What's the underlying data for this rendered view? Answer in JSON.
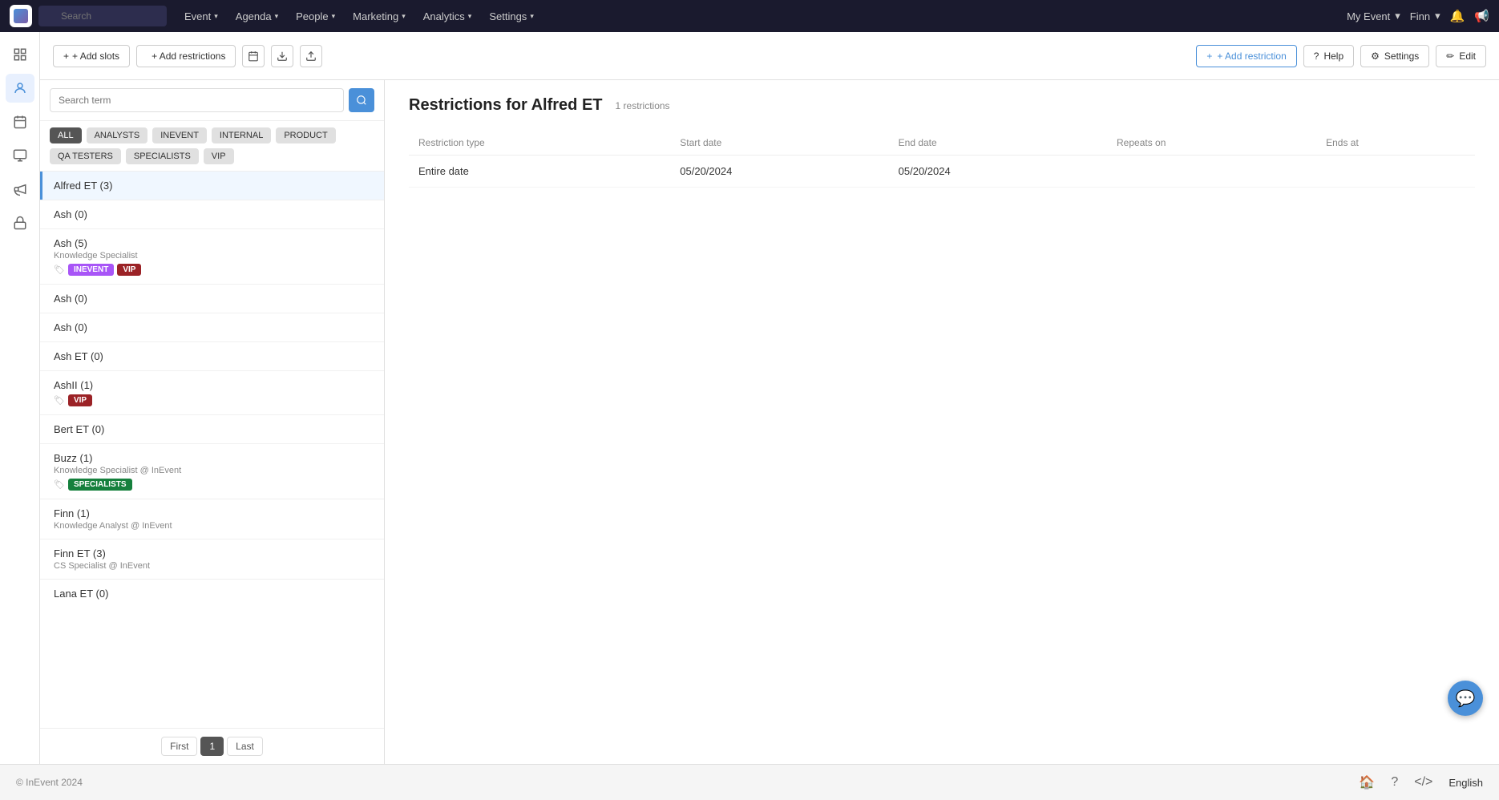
{
  "app": {
    "logo_alt": "InEvent Logo"
  },
  "topnav": {
    "search_placeholder": "Search",
    "items": [
      {
        "label": "Event",
        "has_arrow": true
      },
      {
        "label": "Agenda",
        "has_arrow": true
      },
      {
        "label": "People",
        "has_arrow": true
      },
      {
        "label": "Marketing",
        "has_arrow": true
      },
      {
        "label": "Analytics",
        "has_arrow": true
      },
      {
        "label": "Settings",
        "has_arrow": true
      }
    ],
    "my_event": "My Event",
    "user": "Finn"
  },
  "toolbar": {
    "add_slots_label": "+ Add slots",
    "add_restrictions_label": "+ Add restrictions",
    "add_restriction_label": "+ Add restriction",
    "help_label": "Help",
    "settings_label": "Settings",
    "edit_label": "Edit"
  },
  "left_panel": {
    "search_placeholder": "Search term",
    "filters": [
      {
        "label": "ALL",
        "style": "all"
      },
      {
        "label": "ANALYSTS",
        "style": "default"
      },
      {
        "label": "INEVENT",
        "style": "default"
      },
      {
        "label": "INTERNAL",
        "style": "default"
      },
      {
        "label": "PRODUCT",
        "style": "default"
      },
      {
        "label": "QA TESTERS",
        "style": "default"
      },
      {
        "label": "SPECIALISTS",
        "style": "default"
      },
      {
        "label": "VIP",
        "style": "default"
      }
    ],
    "people": [
      {
        "name": "Alfred ET (3)",
        "role": null,
        "labels": [],
        "active": true
      },
      {
        "name": "Ash (0)",
        "role": null,
        "labels": []
      },
      {
        "name": "Ash (5)",
        "role": "Knowledge Specialist",
        "labels": [
          {
            "text": "INEVENT",
            "style": "invent"
          },
          {
            "text": "VIP",
            "style": "vip"
          }
        ]
      },
      {
        "name": "Ash (0)",
        "role": null,
        "labels": []
      },
      {
        "name": "Ash (0)",
        "role": null,
        "labels": []
      },
      {
        "name": "Ash ET (0)",
        "role": null,
        "labels": []
      },
      {
        "name": "AshII (1)",
        "role": null,
        "labels": [
          {
            "text": "VIP",
            "style": "vip"
          }
        ]
      },
      {
        "name": "Bert ET (0)",
        "role": null,
        "labels": []
      },
      {
        "name": "Buzz (1)",
        "role": "Knowledge Specialist @ InEvent",
        "labels": [
          {
            "text": "SPECIALISTS",
            "style": "specialists"
          }
        ]
      },
      {
        "name": "Finn (1)",
        "role": "Knowledge Analyst @ InEvent",
        "labels": []
      },
      {
        "name": "Finn ET (3)",
        "role": "CS Specialist @ InEvent",
        "labels": []
      },
      {
        "name": "Lana ET (0)",
        "role": null,
        "labels": []
      }
    ],
    "pagination": {
      "first": "First",
      "current": "1",
      "last": "Last"
    }
  },
  "right_panel": {
    "title": "Restrictions for Alfred ET",
    "count": "1 restrictions",
    "columns": [
      "Restriction type",
      "Start date",
      "End date",
      "Repeats on",
      "Ends at"
    ],
    "rows": [
      {
        "type": "Entire date",
        "start_date": "05/20/2024",
        "end_date": "05/20/2024",
        "repeats_on": "",
        "ends_at": ""
      }
    ]
  },
  "footer": {
    "copyright": "© InEvent 2024",
    "language": "English"
  }
}
